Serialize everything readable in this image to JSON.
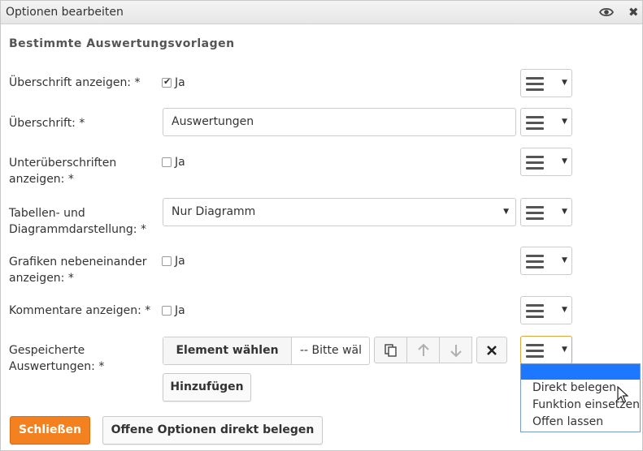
{
  "window": {
    "title": "Optionen bearbeiten",
    "eye_icon": "eye-icon",
    "close_icon": "close-icon",
    "close_glyph": "✖"
  },
  "section_title": "Bestimmte Auswertungsvorlagen",
  "fields": {
    "show_heading": {
      "label": "Überschrift anzeigen: *",
      "checkbox_label": "Ja",
      "checked": true
    },
    "heading": {
      "label": "Überschrift: *",
      "value": "Auswertungen"
    },
    "show_subheadings": {
      "label": "Unterüberschriften anzeigen: *",
      "checkbox_label": "Ja",
      "checked": false
    },
    "display_mode": {
      "label": "Tabellen- und Diagrammdarstellung: *",
      "value": "Nur Diagramm"
    },
    "graphics_side_by_side": {
      "label": "Grafiken nebeneinander anzeigen: *",
      "checkbox_label": "Ja",
      "checked": false
    },
    "show_comments": {
      "label": "Kommentare anzeigen: *",
      "checkbox_label": "Ja",
      "checked": false
    },
    "saved_reports": {
      "label": "Gespeicherte Auswertungen: *",
      "select_element_label": "Element wählen",
      "select_placeholder": "-- Bitte wäl",
      "add_label": "Hinzufügen",
      "tools": [
        "copy-icon",
        "arrow-up-icon",
        "arrow-down-icon",
        "delete-icon"
      ]
    }
  },
  "option_menu": {
    "icon": "hamburger-icon",
    "dropdown_options": [
      "",
      "Direkt belegen",
      "Funktion einsetzen",
      "Offen lassen"
    ]
  },
  "footer": {
    "close_label": "Schließen",
    "assign_open_label": "Offene Optionen direkt belegen"
  },
  "colors": {
    "primary_button": "#f4811f",
    "dropdown_highlight": "#1e78ff",
    "active_border": "#e0a53a"
  }
}
